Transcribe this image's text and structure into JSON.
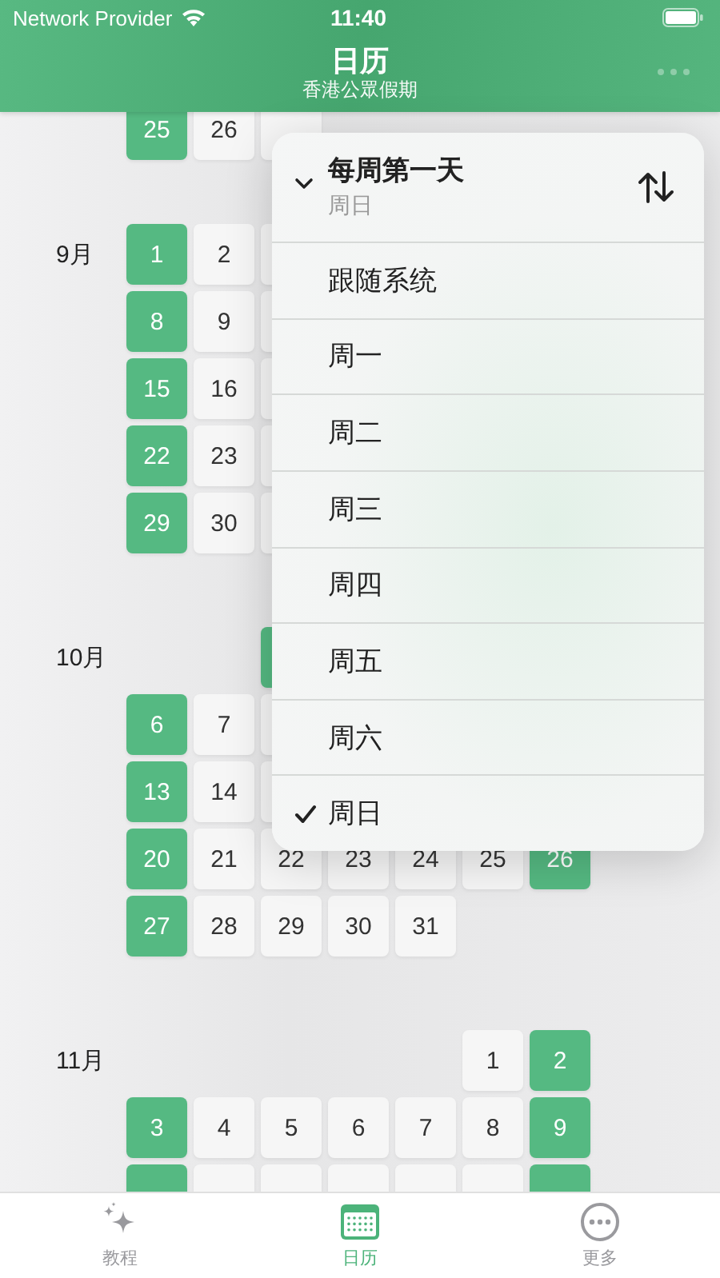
{
  "status_bar": {
    "carrier": "Network Provider",
    "time": "11:40"
  },
  "nav": {
    "title": "日历",
    "subtitle": "香港公眾假期"
  },
  "months": [
    {
      "weeks": [
        [
          {
            "kind": "weekend",
            "day": "25"
          },
          {
            "kind": "weekday",
            "day": "26"
          },
          {
            "kind": "weekday"
          },
          {
            "kind": "blank"
          },
          {
            "kind": "blank"
          },
          {
            "kind": "blank"
          },
          {
            "kind": "blank"
          }
        ]
      ]
    },
    {
      "label": "9月",
      "weeks": [
        [
          {
            "kind": "weekend",
            "day": "1"
          },
          {
            "kind": "weekday",
            "day": "2"
          },
          {
            "kind": "weekday"
          },
          {
            "kind": "blank"
          },
          {
            "kind": "blank"
          },
          {
            "kind": "blank"
          },
          {
            "kind": "blank"
          }
        ],
        [
          {
            "kind": "weekend",
            "day": "8"
          },
          {
            "kind": "weekday",
            "day": "9"
          },
          {
            "kind": "weekday"
          },
          {
            "kind": "blank"
          },
          {
            "kind": "blank"
          },
          {
            "kind": "blank"
          },
          {
            "kind": "blank"
          }
        ],
        [
          {
            "kind": "weekend",
            "day": "15"
          },
          {
            "kind": "weekday",
            "day": "16"
          },
          {
            "kind": "weekday"
          },
          {
            "kind": "blank"
          },
          {
            "kind": "blank"
          },
          {
            "kind": "blank"
          },
          {
            "kind": "blank"
          }
        ],
        [
          {
            "kind": "weekend",
            "day": "22"
          },
          {
            "kind": "weekday",
            "day": "23"
          },
          {
            "kind": "weekday"
          },
          {
            "kind": "blank"
          },
          {
            "kind": "blank"
          },
          {
            "kind": "blank"
          },
          {
            "kind": "blank"
          }
        ],
        [
          {
            "kind": "weekend",
            "day": "29"
          },
          {
            "kind": "weekday",
            "day": "30"
          },
          {
            "kind": "weekday"
          },
          {
            "kind": "blank"
          },
          {
            "kind": "blank"
          },
          {
            "kind": "blank"
          },
          {
            "kind": "blank"
          }
        ]
      ]
    },
    {
      "label": "10月",
      "weeks": [
        [
          {
            "kind": "blank"
          },
          {
            "kind": "blank"
          },
          {
            "kind": "weekend"
          },
          {
            "kind": "blank"
          },
          {
            "kind": "blank"
          },
          {
            "kind": "blank"
          },
          {
            "kind": "blank"
          }
        ],
        [
          {
            "kind": "weekend",
            "day": "6"
          },
          {
            "kind": "weekday",
            "day": "7"
          },
          {
            "kind": "weekday"
          },
          {
            "kind": "blank"
          },
          {
            "kind": "blank"
          },
          {
            "kind": "blank"
          },
          {
            "kind": "blank"
          }
        ],
        [
          {
            "kind": "weekend",
            "day": "13"
          },
          {
            "kind": "weekday",
            "day": "14"
          },
          {
            "kind": "weekday"
          },
          {
            "kind": "blank"
          },
          {
            "kind": "blank"
          },
          {
            "kind": "blank"
          },
          {
            "kind": "blank"
          }
        ],
        [
          {
            "kind": "weekend",
            "day": "20"
          },
          {
            "kind": "weekday",
            "day": "21"
          },
          {
            "kind": "weekday",
            "day": "22"
          },
          {
            "kind": "weekday",
            "day": "23"
          },
          {
            "kind": "weekday",
            "day": "24"
          },
          {
            "kind": "weekday",
            "day": "25"
          },
          {
            "kind": "weekend",
            "day": "26"
          }
        ],
        [
          {
            "kind": "weekend",
            "day": "27"
          },
          {
            "kind": "weekday",
            "day": "28"
          },
          {
            "kind": "weekday",
            "day": "29"
          },
          {
            "kind": "weekday",
            "day": "30"
          },
          {
            "kind": "weekday",
            "day": "31"
          },
          {
            "kind": "blank"
          },
          {
            "kind": "blank"
          }
        ]
      ]
    },
    {
      "label": "11月",
      "weeks": [
        [
          {
            "kind": "blank"
          },
          {
            "kind": "blank"
          },
          {
            "kind": "blank"
          },
          {
            "kind": "blank"
          },
          {
            "kind": "blank"
          },
          {
            "kind": "weekday",
            "day": "1"
          },
          {
            "kind": "weekend",
            "day": "2"
          }
        ],
        [
          {
            "kind": "weekend",
            "day": "3"
          },
          {
            "kind": "weekday",
            "day": "4"
          },
          {
            "kind": "weekday",
            "day": "5"
          },
          {
            "kind": "weekday",
            "day": "6"
          },
          {
            "kind": "weekday",
            "day": "7"
          },
          {
            "kind": "weekday",
            "day": "8"
          },
          {
            "kind": "weekend",
            "day": "9"
          }
        ],
        [
          {
            "kind": "weekend"
          },
          {
            "kind": "weekday"
          },
          {
            "kind": "weekday"
          },
          {
            "kind": "weekday"
          },
          {
            "kind": "weekday"
          },
          {
            "kind": "weekday"
          },
          {
            "kind": "weekend"
          }
        ]
      ]
    }
  ],
  "menu": {
    "title": "每周第一天",
    "value": "周日",
    "expanded": true,
    "options": [
      {
        "label": "跟随系统",
        "selected": false
      },
      {
        "label": "周一",
        "selected": false
      },
      {
        "label": "周二",
        "selected": false
      },
      {
        "label": "周三",
        "selected": false
      },
      {
        "label": "周四",
        "selected": false
      },
      {
        "label": "周五",
        "selected": false
      },
      {
        "label": "周六",
        "selected": false
      },
      {
        "label": "周日",
        "selected": true
      }
    ]
  },
  "tabs": [
    {
      "kind": "tutorial",
      "label": "教程",
      "selected": false
    },
    {
      "kind": "calendar",
      "label": "日历",
      "selected": true
    },
    {
      "kind": "more",
      "label": "更多",
      "selected": false
    }
  ]
}
